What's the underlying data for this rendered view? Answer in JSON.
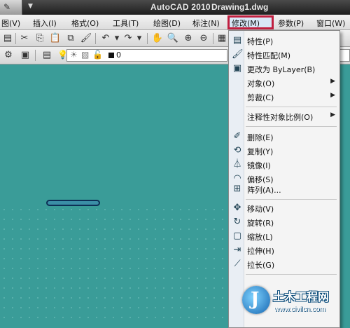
{
  "app": {
    "title": "AutoCAD 2010",
    "document": "Drawing1.dwg"
  },
  "colors": {
    "canvas": "#3a9c98",
    "highlight_box": "#c01f3f",
    "shape_fill": "#3b8ea6",
    "shape_stroke": "#0d2f55"
  },
  "menubar": {
    "items": [
      {
        "label": "图(V)"
      },
      {
        "label": "插入(I)"
      },
      {
        "label": "格式(O)"
      },
      {
        "label": "工具(T)"
      },
      {
        "label": "绘图(D)"
      },
      {
        "label": "标注(N)"
      },
      {
        "label": "修改(M)"
      },
      {
        "label": "参数(P)"
      },
      {
        "label": "窗口(W)"
      }
    ],
    "active": "修改(M)"
  },
  "toolbar2": {
    "layer_value": "0"
  },
  "dropdown": {
    "items": [
      {
        "label": "特性(P)",
        "icon": "properties-icon"
      },
      {
        "label": "特性匹配(M)",
        "icon": "match-properties-icon"
      },
      {
        "label": "更改为 ByLayer(B)",
        "icon": "bylayer-icon"
      },
      {
        "label": "对象(O)",
        "icon": "",
        "submenu": true
      },
      {
        "label": "剪裁(C)",
        "icon": "",
        "submenu": true
      },
      {
        "label": "注释性对象比例(O)",
        "icon": "",
        "submenu": true
      },
      {
        "label": "删除(E)",
        "icon": "erase-icon"
      },
      {
        "label": "复制(Y)",
        "icon": "copy-icon"
      },
      {
        "label": "镜像(I)",
        "icon": "mirror-icon"
      },
      {
        "label": "偏移(S)",
        "icon": "offset-icon"
      },
      {
        "label": "阵列(A)...",
        "icon": "array-icon"
      },
      {
        "label": "移动(V)",
        "icon": "move-icon"
      },
      {
        "label": "旋转(R)",
        "icon": "rotate-icon"
      },
      {
        "label": "缩放(L)",
        "icon": "scale-icon"
      },
      {
        "label": "拉伸(H)",
        "icon": "stretch-icon"
      },
      {
        "label": "拉长(G)",
        "icon": "lengthen-icon"
      }
    ],
    "highlighted": "阵列(A)..."
  },
  "watermark": {
    "name": "土木工程网",
    "url": "www.civilcn.com"
  }
}
